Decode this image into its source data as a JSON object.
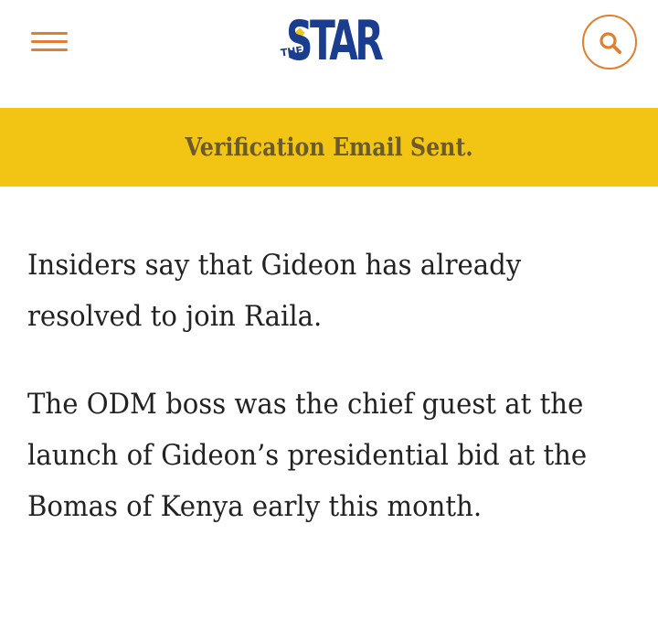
{
  "header": {
    "logo": {
      "the": "THE",
      "star": "STAR"
    },
    "menu_icon": "hamburger-menu-icon",
    "search_icon": "search-icon",
    "accent_color": "#e07f2f",
    "brand_color": "#1b3d8f"
  },
  "banner": {
    "text": "Verification Email Sent.",
    "background": "#f2c515"
  },
  "article": {
    "paragraphs": [
      "Insiders say that Gideon has already resolved to join Raila.",
      "The ODM boss was the chief guest at the launch of Gideon’s presidential bid at the Bomas of Kenya early this month."
    ]
  }
}
